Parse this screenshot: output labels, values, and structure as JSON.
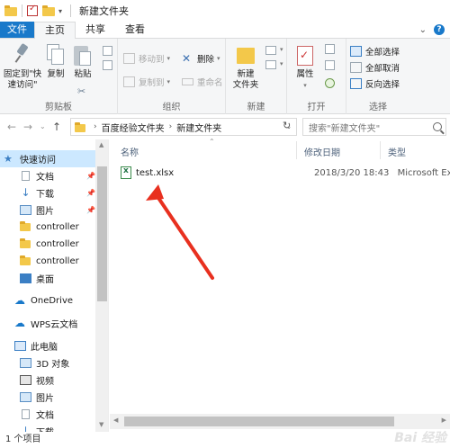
{
  "window": {
    "title": "新建文件夹"
  },
  "tabs": {
    "file": "文件",
    "home": "主页",
    "share": "共享",
    "view": "查看"
  },
  "ribbon": {
    "clipboard": {
      "label": "剪贴板",
      "pin": "固定到\"快\n速访问\"",
      "copy": "复制",
      "paste": "粘贴"
    },
    "organize": {
      "label": "组织",
      "move_to": "移动到",
      "copy_to": "复制到",
      "delete": "删除",
      "rename": "重命名"
    },
    "new": {
      "label": "新建",
      "new_folder": "新建\n文件夹"
    },
    "open": {
      "label": "打开",
      "properties": "属性"
    },
    "select": {
      "label": "选择",
      "select_all": "全部选择",
      "select_none": "全部取消",
      "invert": "反向选择"
    }
  },
  "address": {
    "path": [
      "百度经验文件夹",
      "新建文件夹"
    ]
  },
  "search": {
    "placeholder": "搜索\"新建文件夹\""
  },
  "nav": {
    "items": [
      {
        "label": "快速访问",
        "icon": "star-icon",
        "selected": true
      },
      {
        "label": "文档",
        "icon": "document-folder-icon",
        "pinned": true
      },
      {
        "label": "下载",
        "icon": "download-icon",
        "pinned": true
      },
      {
        "label": "图片",
        "icon": "pictures-icon",
        "pinned": true
      },
      {
        "label": "controller",
        "icon": "folder-icon"
      },
      {
        "label": "controller",
        "icon": "folder-icon"
      },
      {
        "label": "controller",
        "icon": "folder-icon"
      },
      {
        "label": "桌面",
        "icon": "desktop-icon"
      },
      {
        "label": "OneDrive",
        "icon": "cloud-icon"
      },
      {
        "label": "WPS云文档",
        "icon": "cloud-icon"
      },
      {
        "label": "此电脑",
        "icon": "computer-icon"
      },
      {
        "label": "3D 对象",
        "icon": "3d-objects-icon"
      },
      {
        "label": "视频",
        "icon": "video-icon"
      },
      {
        "label": "图片",
        "icon": "pictures-icon"
      },
      {
        "label": "文档",
        "icon": "document-folder-icon"
      },
      {
        "label": "下载",
        "icon": "download-icon"
      }
    ]
  },
  "columns": {
    "name": "名称",
    "modified": "修改日期",
    "type": "类型"
  },
  "files": [
    {
      "name": "test.xlsx",
      "modified": "2018/3/20 18:43",
      "type": "Microsoft Exce"
    }
  ],
  "status": {
    "count": "1 个项目"
  },
  "colors": {
    "accent": "#1979ca",
    "selection": "#cce8ff",
    "arrow": "#e8301f"
  }
}
